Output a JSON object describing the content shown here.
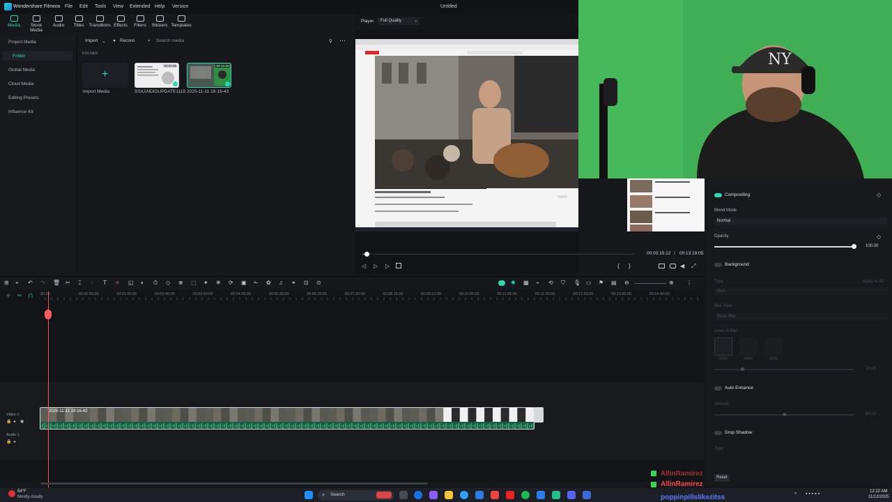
{
  "app": {
    "name": "Wondershare Filmora",
    "document_title": "Untitled",
    "menu": [
      "File",
      "Edit",
      "Tools",
      "View",
      "Extended",
      "Help",
      "Version"
    ]
  },
  "toolbar": {
    "items": [
      "Media",
      "Stock Media",
      "Audio",
      "Titles",
      "Transitions",
      "Effects",
      "Filters",
      "Stickers",
      "Templates"
    ],
    "active": "Media"
  },
  "media_sidebar": {
    "items": [
      "Project Media",
      "Folder",
      "Global Media",
      "Cloud Media",
      "Editing Presets",
      "Influence Kit"
    ],
    "selected": "Folder"
  },
  "media_pane": {
    "import_label": "Import",
    "record_label": "Record",
    "search_placeholder": "Search media",
    "folder_label": "FOLDER",
    "import_media_label": "Import Media",
    "items": [
      {
        "name": "SSXANDIGUPDATE1119",
        "duration": "00:00:05"
      },
      {
        "name": "2025-11-11 19-16-43",
        "duration": "00:13:19"
      }
    ]
  },
  "player": {
    "label": "Player",
    "quality": "Full Quality",
    "current_time": "00:00:15:12",
    "total_time": "00:13:19:05"
  },
  "properties": {
    "compositing": {
      "title": "Compositing",
      "blend_mode_label": "Blend Mode",
      "blend_mode_value": "Normal",
      "opacity_label": "Opacity",
      "opacity_value": "100.00",
      "opacity_fraction": 1.0
    },
    "background": {
      "title": "Background",
      "type_label": "Type",
      "type_value": "Blur",
      "apply_all": "Apply to All",
      "blur_style_label": "Blur Style",
      "blur_style_value": "Basic Blur",
      "level_label": "Level of Blur",
      "level_options": [
        "20%",
        "40%",
        "60%"
      ],
      "level_value": "20.00",
      "level_fraction": 0.2
    },
    "auto_enhance": {
      "title": "Auto Enhance",
      "amount_label": "Amount",
      "amount_value": "50.00",
      "amount_fraction": 0.5
    },
    "drop_shadow": {
      "title": "Drop Shadow",
      "type_label": "Type"
    },
    "reset_label": "Reset"
  },
  "timeline": {
    "ruler_labels": [
      "00:00",
      "00:00:55:00",
      "00:01:50:00",
      "00:02:45:00",
      "00:03:40:00",
      "00:04:35:00",
      "00:05:30:00",
      "00:06:25:00",
      "00:07:20:00",
      "00:08:15:00",
      "00:09:10:00",
      "00:10:05:00",
      "00:11:00:00",
      "00:11:55:00",
      "00:12:50:00",
      "00:13:45:00",
      "00:14:40:00"
    ],
    "video_track_label": "Video 1",
    "audio_track_label": "Audio 1",
    "clip_label": "2025-11-11 19-16-43"
  },
  "chat": [
    {
      "user": "AllinRamirez",
      "color": "#ff4646"
    },
    {
      "user": "AllinRamirez",
      "color": "#ff4646"
    },
    {
      "user": "poppinpillslikezitss",
      "color": "#5c7cff"
    }
  ],
  "taskbar": {
    "weather_temp": "54°F",
    "weather_desc": "Mostly cloudy",
    "search_placeholder": "Search",
    "clock_time": "12:22 AM",
    "clock_date": "11/12/2025"
  },
  "colors": {
    "accent": "#2ed6b4",
    "playhead": "#ff5a5a",
    "green_screen": "#3fae55"
  }
}
